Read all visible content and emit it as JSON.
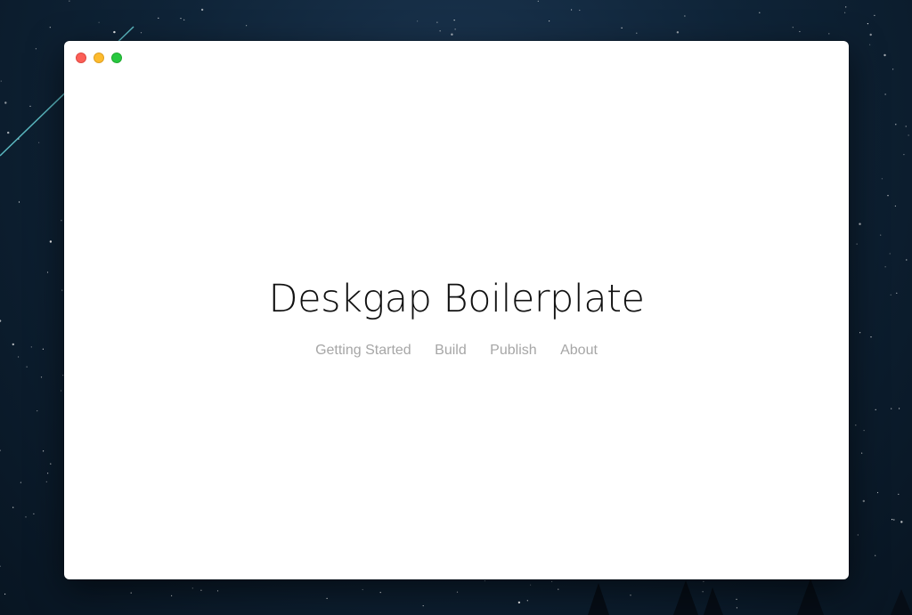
{
  "window": {
    "controls": {
      "close_color": "#fc5f57",
      "minimize_color": "#fdbb2e",
      "zoom_color": "#28c840"
    }
  },
  "main": {
    "title": "Deskgap Boilerplate",
    "nav": [
      {
        "label": "Getting Started"
      },
      {
        "label": "Build"
      },
      {
        "label": "Publish"
      },
      {
        "label": "About"
      }
    ]
  },
  "colors": {
    "title": "#111111",
    "nav_link": "#a6a6a6",
    "window_bg": "#ffffff",
    "desktop_bg": "#0f2438"
  }
}
